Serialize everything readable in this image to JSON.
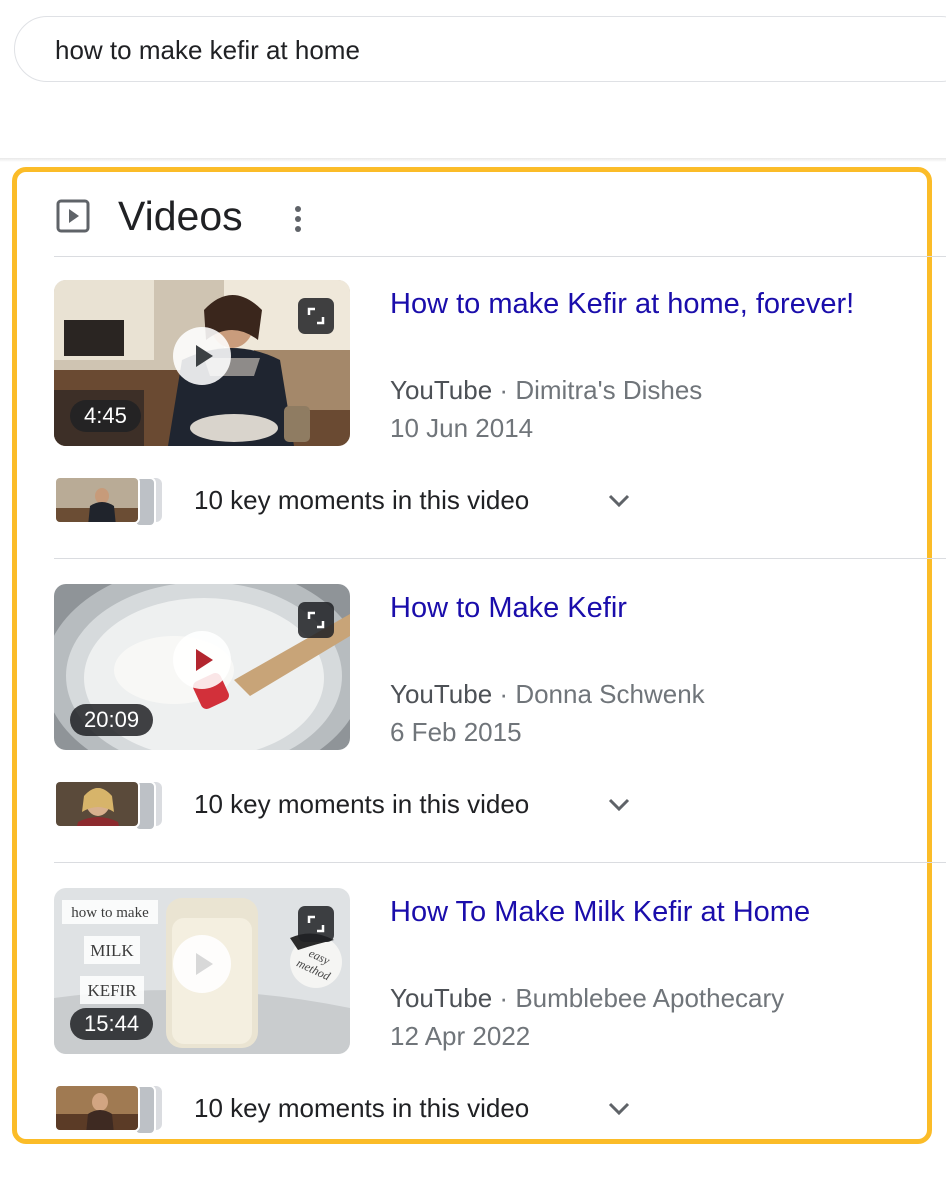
{
  "search": {
    "query": "how to make kefir at home"
  },
  "videos_section": {
    "title": "Videos",
    "icon": "play-box-icon",
    "more_icon": "more-vert-icon"
  },
  "results": [
    {
      "title": "How to make Kefir at home, forever!",
      "source": "YouTube",
      "separator": "·",
      "channel": "Dimitra's Dishes",
      "date": "10 Jun 2014",
      "duration": "4:45",
      "key_moments": "10 key moments in this video"
    },
    {
      "title": "How to Make Kefir",
      "source": "YouTube",
      "separator": "·",
      "channel": "Donna Schwenk",
      "date": "6 Feb 2015",
      "duration": "20:09",
      "key_moments": "10 key moments in this video"
    },
    {
      "title": "How To Make Milk Kefir at Home",
      "source": "YouTube",
      "separator": "·",
      "channel": "Bumblebee Apothecary",
      "date": "12 Apr 2022",
      "duration": "15:44",
      "key_moments": "10 key moments in this video",
      "thumbnail_text": [
        "how to make",
        "MILK",
        "KEFIR",
        "easy",
        "method"
      ]
    }
  ],
  "colors": {
    "link": "#1a0dab",
    "highlight_border": "#fbbc28",
    "meta": "#70757a"
  }
}
